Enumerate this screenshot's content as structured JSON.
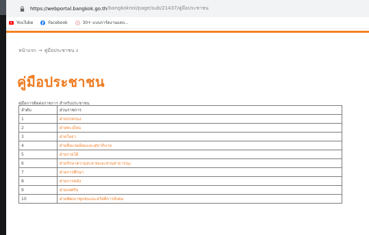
{
  "browser": {
    "url_host": "https://webportal.bangkok.go.th",
    "url_path": "/bangkoknoi/page/sub/21437/คู่มือประชาชน",
    "bookmarks": [
      {
        "label": "YouTube",
        "icon": "youtube-icon",
        "color": "#ff0000"
      },
      {
        "label": "Facebook",
        "icon": "facebook-icon",
        "color": "#1877f2"
      },
      {
        "label": "30+ แบบการ์ดงานแต่ง...",
        "icon": "bookmark-site-icon",
        "color": "#e8a0a0"
      }
    ]
  },
  "colors": {
    "accent": "#f58220",
    "title": "#ee7b21",
    "link": "#f07f2a"
  },
  "breadcrumb": {
    "home": "หน้าแรก",
    "arrow": "→",
    "current": "คู่มือประชาชน ง"
  },
  "page_title": "คู่มือประชาชน",
  "table": {
    "caption": "คู่มือการติดต่อราชการ สำหรับประชาชน",
    "headers": [
      "ลำดับ",
      "ส่วนราชการ"
    ],
    "rows": [
      {
        "num": "1",
        "name": "ฝ่ายปกครอง"
      },
      {
        "num": "2",
        "name": "ฝ่ายทะเบียน"
      },
      {
        "num": "3",
        "name": "ฝ่ายโยธา"
      },
      {
        "num": "4",
        "name": "ฝ่ายสิ่งแวดล้อมและสุขาภิบาล"
      },
      {
        "num": "5",
        "name": "ฝ่ายรายได้"
      },
      {
        "num": "6",
        "name": "ฝ่ายรักษาความสะอาดและสวนสาธารณะ"
      },
      {
        "num": "7",
        "name": "ฝ่ายการศึกษา"
      },
      {
        "num": "8",
        "name": "ฝ่ายการคลัง"
      },
      {
        "num": "9",
        "name": "ฝ่ายเทศกิจ"
      },
      {
        "num": "10",
        "name": "ฝ่ายพัฒนาชุมชนและสวัสดิการสังคม"
      }
    ]
  }
}
